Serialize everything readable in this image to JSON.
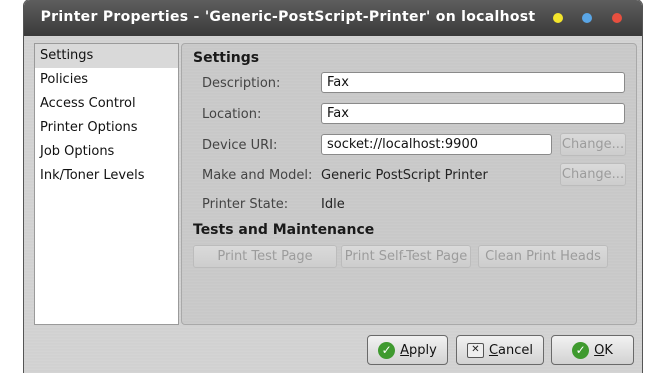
{
  "window": {
    "title": "Printer Properties - 'Generic-PostScript-Printer' on localhost"
  },
  "sidebar": {
    "items": [
      {
        "label": "Settings"
      },
      {
        "label": "Policies"
      },
      {
        "label": "Access Control"
      },
      {
        "label": "Printer Options"
      },
      {
        "label": "Job Options"
      },
      {
        "label": "Ink/Toner Levels"
      }
    ]
  },
  "settings": {
    "heading": "Settings",
    "description": {
      "label": "Description:",
      "value": "Fax"
    },
    "location": {
      "label": "Location:",
      "value": "Fax"
    },
    "device_uri": {
      "label": "Device URI:",
      "value": "socket://localhost:9900",
      "change": "Change..."
    },
    "make_model": {
      "label": "Make and Model:",
      "value": "Generic PostScript Printer",
      "change": "Change..."
    },
    "state": {
      "label": "Printer State:",
      "value": "Idle"
    }
  },
  "tests": {
    "heading": "Tests and Maintenance",
    "print_test": "Print Test Page",
    "self_test": "Print Self-Test Page",
    "clean_heads": "Clean Print Heads"
  },
  "footer": {
    "apply_first": "A",
    "apply_rest": "pply",
    "cancel_first": "C",
    "cancel_rest": "ancel",
    "ok_first": "O",
    "ok_rest": "K"
  }
}
